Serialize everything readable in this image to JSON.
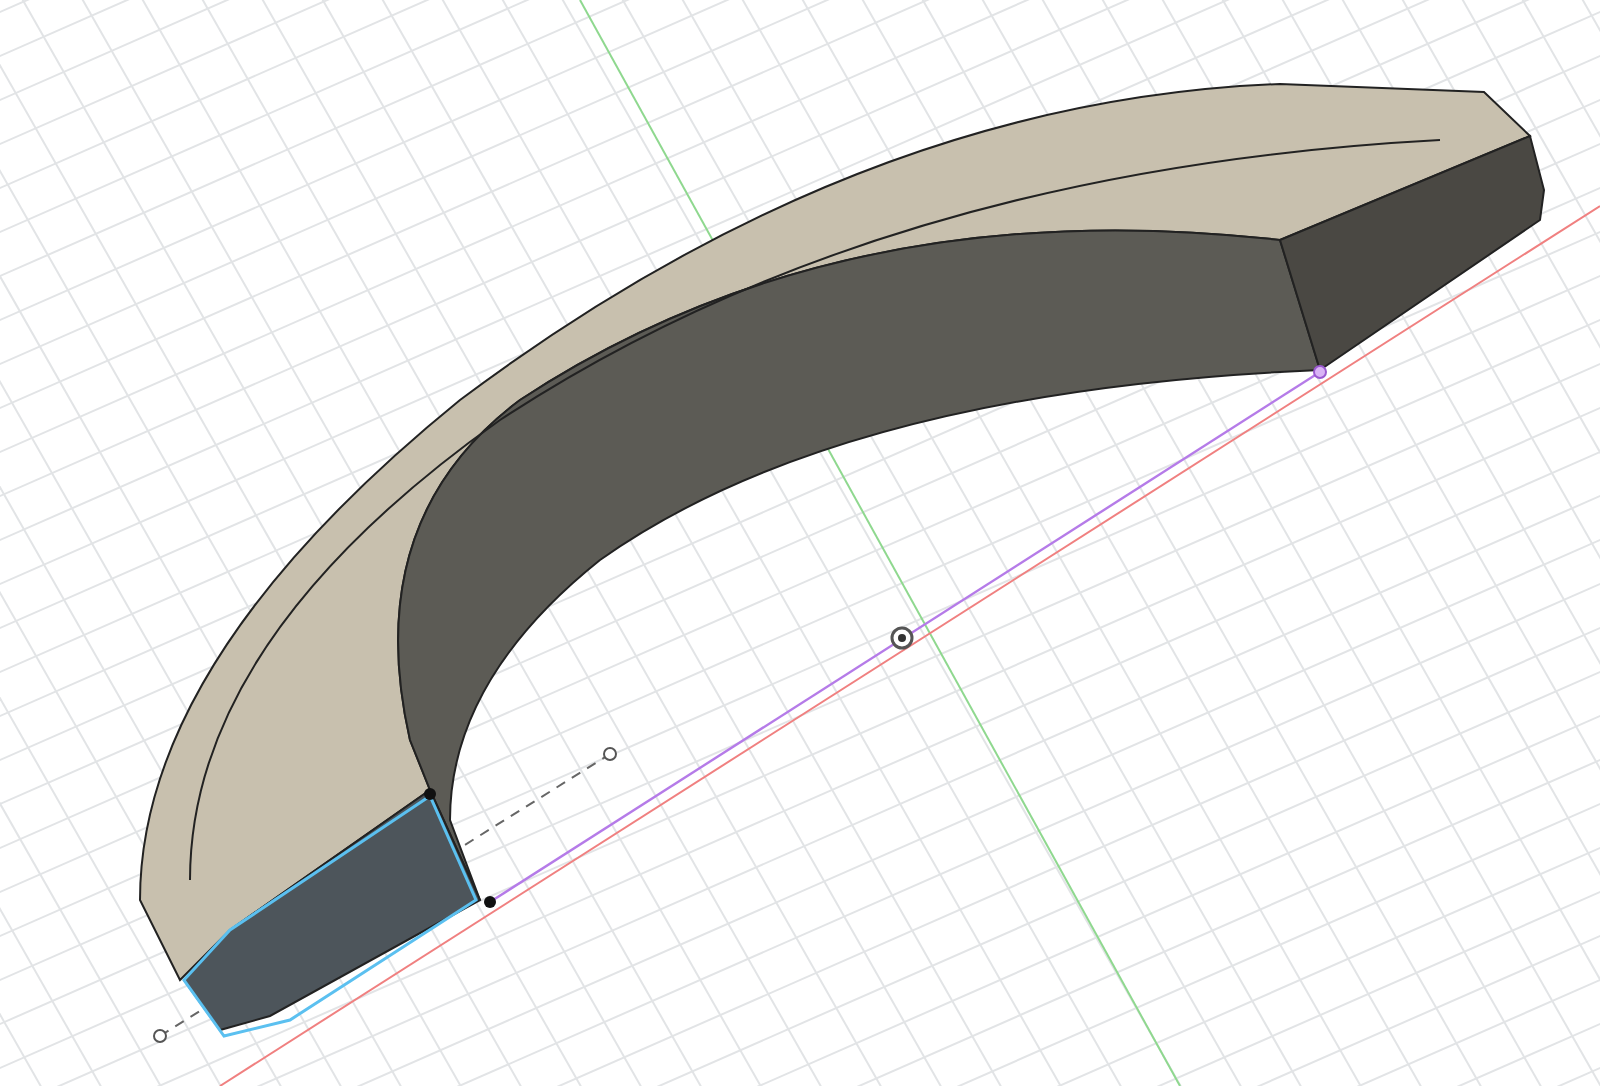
{
  "viewport": {
    "grid": true,
    "selection": true
  }
}
